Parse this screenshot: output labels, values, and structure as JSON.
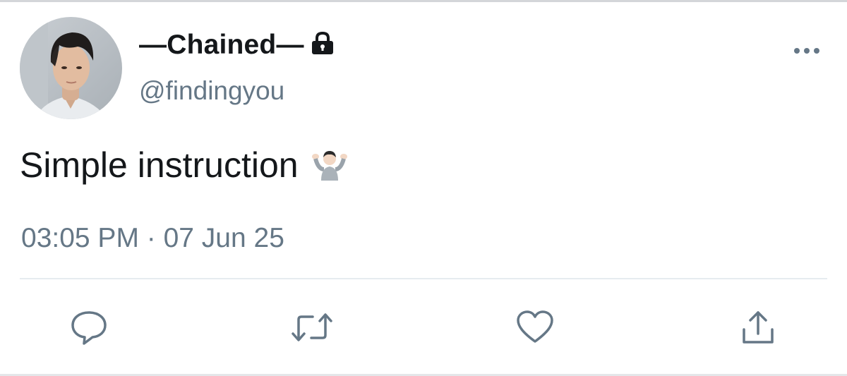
{
  "tweet": {
    "display_name": "—Chained—",
    "handle": "@findingyou",
    "protected_icon": "lock-icon",
    "text": "Simple instruction",
    "emoji": "person-shrugging-emoji",
    "timestamp": "03:05 PM · 07 Jun 25"
  },
  "actions": [
    {
      "name": "reply",
      "icon": "speech-bubble-icon"
    },
    {
      "name": "retweet",
      "icon": "retweet-arrows-icon"
    },
    {
      "name": "like",
      "icon": "heart-icon"
    },
    {
      "name": "share",
      "icon": "share-upload-icon"
    }
  ],
  "colors": {
    "text": "#14171a",
    "secondary": "#657786",
    "divider": "#e6ecf0",
    "background": "#ffffff"
  }
}
